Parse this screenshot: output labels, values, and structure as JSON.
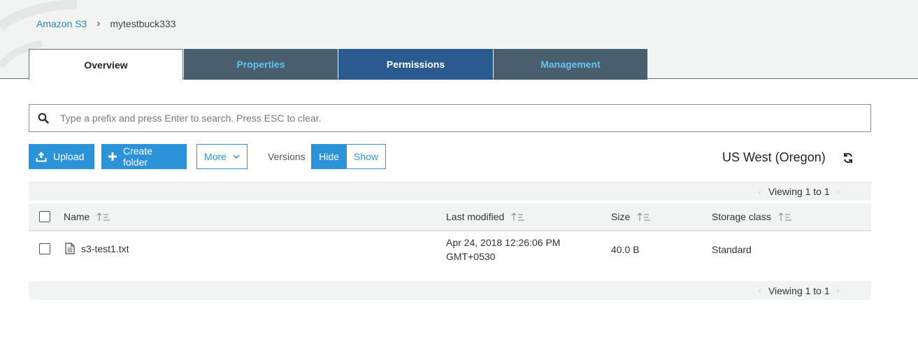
{
  "breadcrumb": {
    "root": "Amazon S3",
    "separator": "›",
    "current": "mytestbuck333"
  },
  "tabs": [
    {
      "label": "Overview",
      "active": true
    },
    {
      "label": "Properties",
      "active": false
    },
    {
      "label": "Permissions",
      "active": false
    },
    {
      "label": "Management",
      "active": false
    }
  ],
  "search": {
    "placeholder": "Type a prefix and press Enter to search. Press ESC to clear.",
    "value": ""
  },
  "toolbar": {
    "upload_label": "Upload",
    "create_folder_label": "Create folder",
    "more_label": "More",
    "versions_label": "Versions",
    "hide_label": "Hide",
    "show_label": "Show",
    "versions_selected": "Hide"
  },
  "region": "US West (Oregon)",
  "pager": {
    "top_text": "Viewing 1 to 1",
    "bottom_text": "Viewing 1 to 1"
  },
  "table": {
    "columns": [
      "Name",
      "Last modified",
      "Size",
      "Storage class"
    ],
    "rows": [
      {
        "name": "s3-test1.txt",
        "modified_line1": "Apr 24, 2018 12:26:06 PM",
        "modified_line2": "GMT+0530",
        "size": "40.0 B",
        "storage_class": "Standard",
        "icon": "file-icon"
      }
    ]
  },
  "colors": {
    "primary": "#2d93d9",
    "tab_dark": "#4a5f6d",
    "tab_permissions": "#2a5a8f",
    "tab_text_accent": "#5ec4f2",
    "link": "#2e84c4"
  }
}
